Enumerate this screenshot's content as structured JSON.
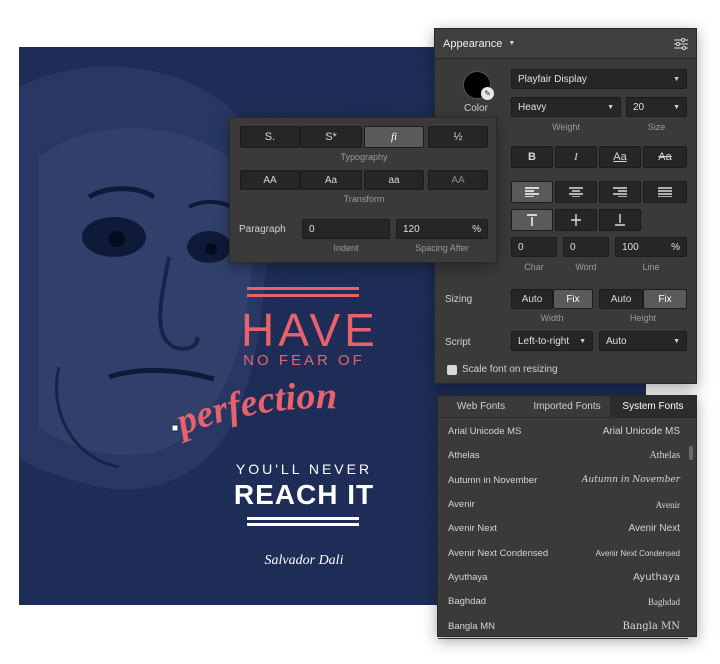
{
  "poster": {
    "line1": "HAVE",
    "line2": "NO FEAR OF",
    "line3": "perfection",
    "line4": "YOU'LL NEVER",
    "line5": "REACH IT",
    "signature": "Salvador Dali",
    "colors": {
      "background": "#1b2a55",
      "accent": "#e8626c",
      "text": "#ffffff"
    }
  },
  "appearance": {
    "title": "Appearance",
    "font_family": "Playfair Display",
    "color_label": "Color",
    "weight_value": "Heavy",
    "weight_label": "Weight",
    "size_value": "20",
    "size_label": "Size",
    "style_bold": "B",
    "style_italic": "I",
    "style_underline": "Aa",
    "style_strike": "Aa",
    "char_value": "0",
    "char_label": "Char",
    "word_value": "0",
    "word_label": "Word",
    "line_value": "100",
    "line_unit": "%",
    "line_label": "Line",
    "sizing_label": "Sizing",
    "width_auto": "Auto",
    "width_fix": "Fix",
    "width_label": "Width",
    "height_auto": "Auto",
    "height_fix": "Fix",
    "height_label": "Height",
    "script_label": "Script",
    "script_value": "Left-to-right",
    "script_auto": "Auto",
    "scale_label": "Scale font on resizing"
  },
  "typography": {
    "btn1": "S.",
    "btn2": "S*",
    "btn3": "fi",
    "btn4": "½",
    "typography_label": "Typography",
    "t1": "AA",
    "t2": "Aa",
    "t3": "aa",
    "t4": "AA",
    "transform_label": "Transform",
    "paragraph_label": "Paragraph",
    "indent_value": "0",
    "indent_label": "Indent",
    "spacing_value": "120",
    "spacing_unit": "%",
    "spacing_label": "Spacing After"
  },
  "fonts": {
    "tabs": [
      "Web Fonts",
      "Imported Fonts",
      "System Fonts"
    ],
    "list": [
      {
        "name": "Arial Unicode MS",
        "preview": "Arial Unicode MS"
      },
      {
        "name": "Athelas",
        "preview": "Athelas"
      },
      {
        "name": "Autumn in November",
        "preview": "Autumn in November"
      },
      {
        "name": "Avenir",
        "preview": "Avenir"
      },
      {
        "name": "Avenir Next",
        "preview": "Avenir Next"
      },
      {
        "name": "Avenir Next Condensed",
        "preview": "Avenir Next Condensed"
      },
      {
        "name": "Ayuthaya",
        "preview": "Ayuthaya"
      },
      {
        "name": "Baghdad",
        "preview": "Baghdad"
      },
      {
        "name": "Bangla MN",
        "preview": "Bangla MN"
      }
    ]
  }
}
